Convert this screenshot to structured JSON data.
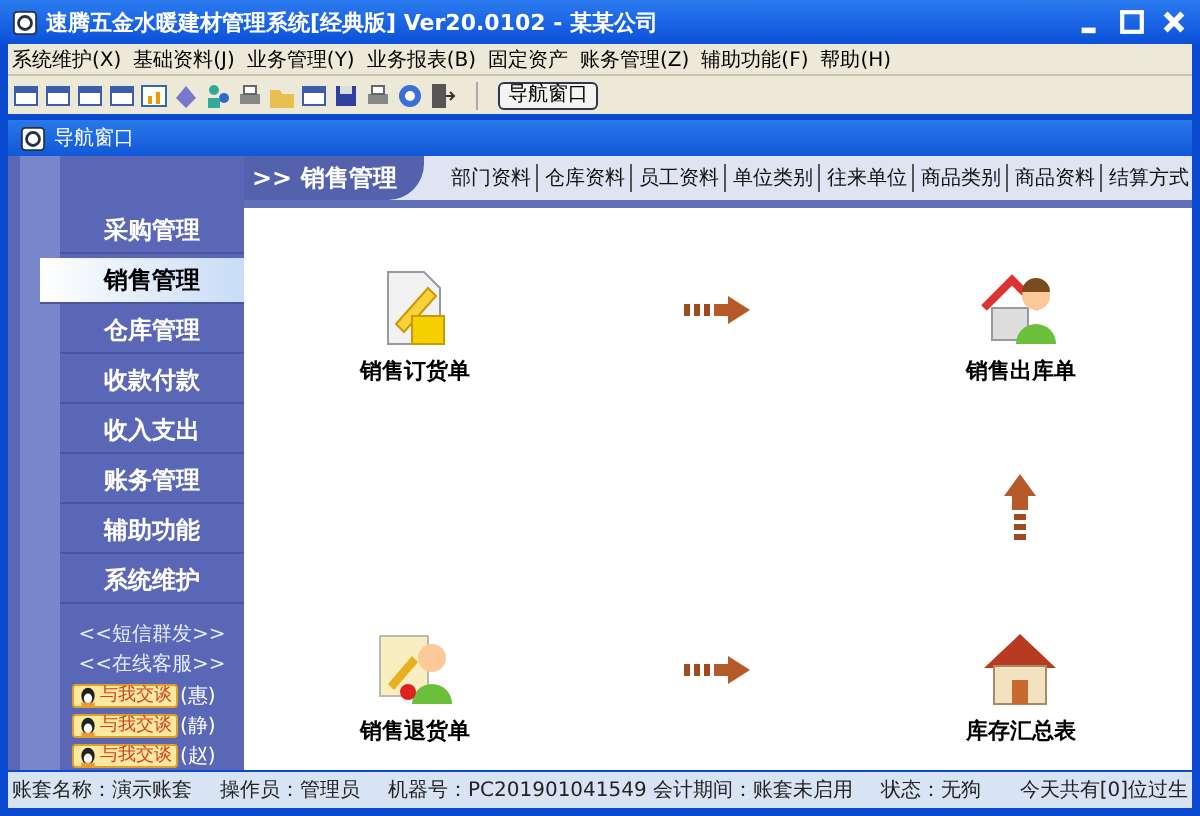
{
  "window": {
    "title": "速腾五金水暖建材管理系统[经典版] Ver20.0102  -  某某公司"
  },
  "menu": [
    "系统维护(X)",
    "基础资料(J)",
    "业务管理(Y)",
    "业务报表(B)",
    "固定资产",
    "账务管理(Z)",
    "辅助功能(F)",
    "帮助(H)"
  ],
  "toolbar": {
    "nav_button": "导航窗口"
  },
  "nav_window": {
    "title": "导航窗口"
  },
  "sidebar": {
    "items": [
      {
        "label": "采购管理",
        "selected": false
      },
      {
        "label": "销售管理",
        "selected": true
      },
      {
        "label": "仓库管理",
        "selected": false
      },
      {
        "label": "收款付款",
        "selected": false
      },
      {
        "label": "收入支出",
        "selected": false
      },
      {
        "label": "账务管理",
        "selected": false
      },
      {
        "label": "辅助功能",
        "selected": false
      },
      {
        "label": "系统维护",
        "selected": false
      }
    ],
    "links": [
      "<<短信群发>>",
      "<<在线客服>>"
    ],
    "chat": [
      {
        "button": "与我交谈",
        "name": "(惠)"
      },
      {
        "button": "与我交谈",
        "name": "(静)"
      },
      {
        "button": "与我交谈",
        "name": "(赵)"
      }
    ]
  },
  "section": {
    "title": ">> 销售管理",
    "links": [
      "部门资料",
      "仓库资料",
      "员工资料",
      "单位类别",
      "往来单位",
      "商品类别",
      "商品资料",
      "结算方式"
    ]
  },
  "flow": [
    {
      "kind": "order",
      "label": "销售订货单"
    },
    {
      "kind": "arrow-right"
    },
    {
      "kind": "outbound",
      "label": "销售出库单"
    },
    {
      "kind": "blank"
    },
    {
      "kind": "blank"
    },
    {
      "kind": "arrow-up"
    },
    {
      "kind": "return",
      "label": "销售退货单"
    },
    {
      "kind": "arrow-right"
    },
    {
      "kind": "summary",
      "label": "库存汇总表"
    }
  ],
  "status_bar": [
    "账套名称：演示账套",
    "操作员：管理员",
    "机器号：PC201901041549 会计期间：账套未启用",
    "状态：无狗",
    "今天共有[0]位过生"
  ]
}
